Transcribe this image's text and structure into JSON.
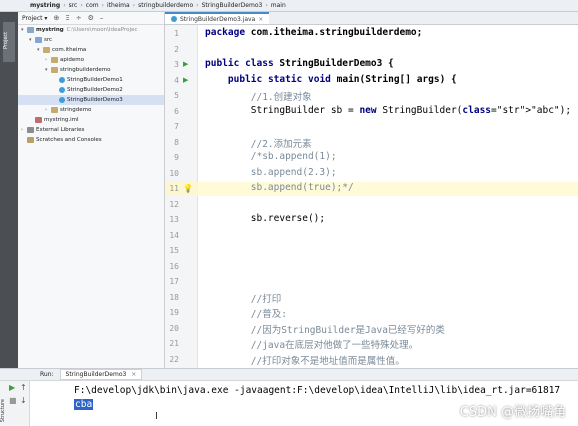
{
  "breadcrumb": [
    "mystring",
    "src",
    "com",
    "itheima",
    "stringbuilderdemo",
    "StringBuilderDemo3",
    "main"
  ],
  "sidebar": {
    "vertical_tab": "Project",
    "toolbar_title": "Project ▾",
    "toolbar_icons": [
      "⊕",
      "Ξ",
      "÷",
      "⚙",
      "–"
    ]
  },
  "tree": [
    {
      "label": "mystring",
      "path": "C:\\Users\\moon\\IdeaProjec",
      "indent": 0,
      "icon": "module",
      "arrow": "▾",
      "selected": false,
      "bold": true
    },
    {
      "label": "src",
      "indent": 1,
      "icon": "folder",
      "arrow": "▾",
      "selected": false
    },
    {
      "label": "com.itheima",
      "indent": 2,
      "icon": "package",
      "arrow": "▾",
      "selected": false
    },
    {
      "label": "apidemo",
      "indent": 3,
      "icon": "package",
      "arrow": "›",
      "selected": false
    },
    {
      "label": "stringbuilderdemo",
      "indent": 3,
      "icon": "package",
      "arrow": "▾",
      "selected": false
    },
    {
      "label": "StringBuilderDemo1",
      "indent": 4,
      "icon": "classf",
      "arrow": "",
      "selected": false
    },
    {
      "label": "StringBuilderDemo2",
      "indent": 4,
      "icon": "classf",
      "arrow": "",
      "selected": false
    },
    {
      "label": "StringBuilderDemo3",
      "indent": 4,
      "icon": "classf",
      "arrow": "",
      "selected": true
    },
    {
      "label": "stringdemo",
      "indent": 3,
      "icon": "package",
      "arrow": "›",
      "selected": false
    },
    {
      "label": "mystring.iml",
      "indent": 1,
      "icon": "iml",
      "arrow": "",
      "selected": false
    },
    {
      "label": "External Libraries",
      "indent": 0,
      "icon": "lib",
      "arrow": "›",
      "selected": false
    },
    {
      "label": "Scratches and Consoles",
      "indent": 0,
      "icon": "scratch",
      "arrow": "",
      "selected": false
    }
  ],
  "editor": {
    "tab_label": "StringBuilderDemo3.java",
    "tab_close": "×",
    "line_numbers": [
      "1",
      "2",
      "3",
      "4",
      "5",
      "6",
      "7",
      "8",
      "9",
      "10",
      "11",
      "12",
      "13",
      "14",
      "15",
      "16",
      "17",
      "18",
      "19",
      "20",
      "21",
      "22"
    ],
    "lines": [
      {
        "text": "package com.itheima.stringbuilderdemo;",
        "style": "struct"
      },
      {
        "text": "",
        "style": ""
      },
      {
        "text": "public class StringBuilderDemo3 {",
        "style": "struct"
      },
      {
        "text": "    public static void main(String[] args) {",
        "style": "struct"
      },
      {
        "text": "        //1.创建对象",
        "style": "comment"
      },
      {
        "text": "        StringBuilder sb = new StringBuilder(\"abc\");",
        "style": "code"
      },
      {
        "text": "",
        "style": ""
      },
      {
        "text": "        //2.添加元素",
        "style": "comment"
      },
      {
        "text": "        /*sb.append(1);",
        "style": "comment"
      },
      {
        "text": "        sb.append(2.3);",
        "style": "comment"
      },
      {
        "text": "        sb.append(true);*/",
        "style": "comment"
      },
      {
        "text": "",
        "style": ""
      },
      {
        "text": "        sb.reverse();",
        "style": "code"
      },
      {
        "text": "",
        "style": ""
      },
      {
        "text": "",
        "style": ""
      },
      {
        "text": "",
        "style": ""
      },
      {
        "text": "",
        "style": ""
      },
      {
        "text": "        //打印",
        "style": "comment"
      },
      {
        "text": "        //普及:",
        "style": "comment"
      },
      {
        "text": "        //因为StringBuilder是Java已经写好的类",
        "style": "comment"
      },
      {
        "text": "        //java在底层对他做了一些特殊处理。",
        "style": "comment"
      },
      {
        "text": "        //打印对象不是地址值而是属性值。",
        "style": "comment"
      }
    ],
    "current_line": 11
  },
  "run": {
    "label": "Run:",
    "tab_label": "StringBuilderDemo3",
    "tab_close": "×",
    "command": "F:\\develop\\jdk\\bin\\java.exe -javaagent:F:\\develop\\idea\\IntelliJ\\lib\\idea_rt.jar=61817",
    "output": "cba",
    "strip_vertical": "Structure"
  },
  "watermark": "CSDN @微扬嘴角"
}
